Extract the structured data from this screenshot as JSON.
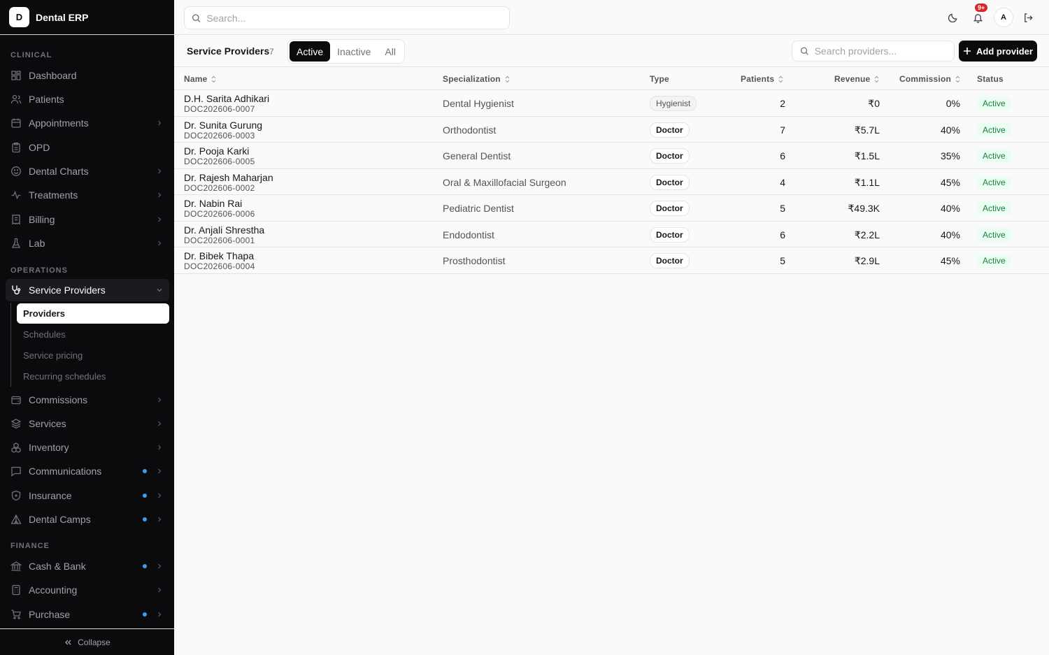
{
  "app": {
    "logo_letter": "D",
    "name": "Dental ERP"
  },
  "sidebar": {
    "sections": {
      "clinical": "CLINICAL",
      "operations": "OPERATIONS",
      "finance": "FINANCE"
    },
    "clinical": [
      {
        "label": "Dashboard",
        "icon": "dashboard-icon"
      },
      {
        "label": "Patients",
        "icon": "patients-icon"
      },
      {
        "label": "Appointments",
        "icon": "calendar-icon"
      },
      {
        "label": "OPD",
        "icon": "clipboard-icon"
      },
      {
        "label": "Dental Charts",
        "icon": "smile-icon"
      },
      {
        "label": "Treatments",
        "icon": "activity-icon"
      },
      {
        "label": "Billing",
        "icon": "receipt-icon"
      },
      {
        "label": "Lab",
        "icon": "flask-icon"
      }
    ],
    "operations_group": "Service Providers",
    "operations_sub": [
      "Providers",
      "Schedules",
      "Service pricing",
      "Recurring schedules"
    ],
    "operations": [
      {
        "label": "Commissions",
        "icon": "wallet-icon"
      },
      {
        "label": "Services",
        "icon": "layers-icon"
      },
      {
        "label": "Inventory",
        "icon": "boxes-icon"
      },
      {
        "label": "Communications",
        "icon": "message-icon"
      },
      {
        "label": "Insurance",
        "icon": "shield-icon"
      },
      {
        "label": "Dental Camps",
        "icon": "tent-icon"
      }
    ],
    "finance": [
      {
        "label": "Cash & Bank",
        "icon": "bank-icon"
      },
      {
        "label": "Accounting",
        "icon": "calculator-icon"
      },
      {
        "label": "Purchase",
        "icon": "cart-icon"
      }
    ],
    "collapse_label": "Collapse"
  },
  "topbar": {
    "search_placeholder": "Search...",
    "notif_badge": "9+",
    "avatar_letter": "A"
  },
  "page": {
    "title": "Service Providers",
    "count": "7",
    "filters": [
      "Active",
      "Inactive",
      "All"
    ],
    "active_filter": "Active",
    "search_placeholder": "Search providers...",
    "add_label": "Add provider"
  },
  "table": {
    "headers": {
      "name": "Name",
      "specialization": "Specialization",
      "type": "Type",
      "patients": "Patients",
      "revenue": "Revenue",
      "commission": "Commission",
      "status": "Status"
    },
    "rows": [
      {
        "name": "D.H. Sarita Adhikari",
        "code": "DOC202606-0007",
        "specialization": "Dental Hygienist",
        "type": "Hygienist",
        "patients": "2",
        "revenue": "₹0",
        "commission": "0%",
        "status": "Active"
      },
      {
        "name": "Dr. Sunita Gurung",
        "code": "DOC202606-0003",
        "specialization": "Orthodontist",
        "type": "Doctor",
        "patients": "7",
        "revenue": "₹5.7L",
        "commission": "40%",
        "status": "Active"
      },
      {
        "name": "Dr. Pooja Karki",
        "code": "DOC202606-0005",
        "specialization": "General Dentist",
        "type": "Doctor",
        "patients": "6",
        "revenue": "₹1.5L",
        "commission": "35%",
        "status": "Active"
      },
      {
        "name": "Dr. Rajesh Maharjan",
        "code": "DOC202606-0002",
        "specialization": "Oral & Maxillofacial Surgeon",
        "type": "Doctor",
        "patients": "4",
        "revenue": "₹1.1L",
        "commission": "45%",
        "status": "Active"
      },
      {
        "name": "Dr. Nabin Rai",
        "code": "DOC202606-0006",
        "specialization": "Pediatric Dentist",
        "type": "Doctor",
        "patients": "5",
        "revenue": "₹49.3K",
        "commission": "40%",
        "status": "Active"
      },
      {
        "name": "Dr. Anjali Shrestha",
        "code": "DOC202606-0001",
        "specialization": "Endodontist",
        "type": "Doctor",
        "patients": "6",
        "revenue": "₹2.2L",
        "commission": "40%",
        "status": "Active"
      },
      {
        "name": "Dr. Bibek Thapa",
        "code": "DOC202606-0004",
        "specialization": "Prosthodontist",
        "type": "Doctor",
        "patients": "5",
        "revenue": "₹2.9L",
        "commission": "45%",
        "status": "Active"
      }
    ]
  },
  "colors": {
    "sidebar_bg": "#0b0b0e",
    "accent_dot": "#3b9ef5",
    "badge": "#dc2626",
    "status_green": "#15803d"
  }
}
